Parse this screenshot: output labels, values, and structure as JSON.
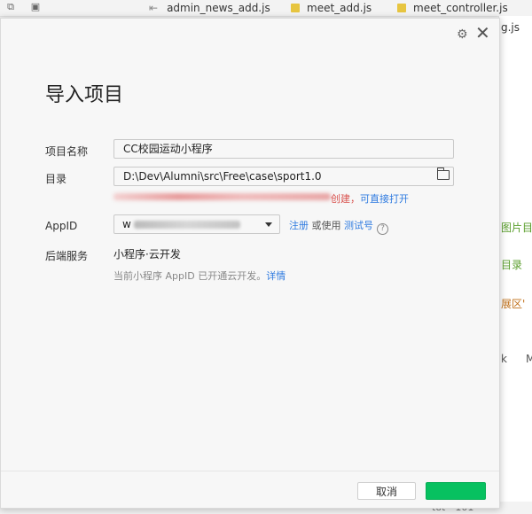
{
  "editor_tabs": [
    {
      "label": "admin_news_add.js"
    },
    {
      "label": "meet_add.js"
    },
    {
      "label": "meet_controller.js"
    },
    {
      "label": "g.js"
    }
  ],
  "right_panel": {
    "items": [
      "图片目",
      "目录",
      "展区'",
      "k",
      "M"
    ],
    "bottom_code": "tot - 101"
  },
  "dialog": {
    "title": "导入项目",
    "fields": {
      "project_name": {
        "label": "项目名称",
        "value": "CC校园运动小程序"
      },
      "directory": {
        "label": "目录",
        "value": "D:\\Dev\\Alumni\\src\\Free\\case\\sport1.0"
      },
      "appid": {
        "label": "AppID",
        "value_prefix": "w"
      },
      "backend": {
        "label": "后端服务",
        "value": "小程序·云开发"
      }
    },
    "directory_warning": {
      "text": "创建，",
      "link": "可直接打开"
    },
    "appid_links": {
      "register": "注册",
      "or_use": " 或使用 ",
      "test_account": "测试号"
    },
    "backend_note": {
      "text": "当前小程序 AppID 已开通云开发。",
      "link": "详情"
    },
    "buttons": {
      "cancel": "取消",
      "import": ""
    }
  },
  "colors": {
    "accent": "#07c160",
    "link": "#2f7be0",
    "warning": "#d9534f"
  }
}
